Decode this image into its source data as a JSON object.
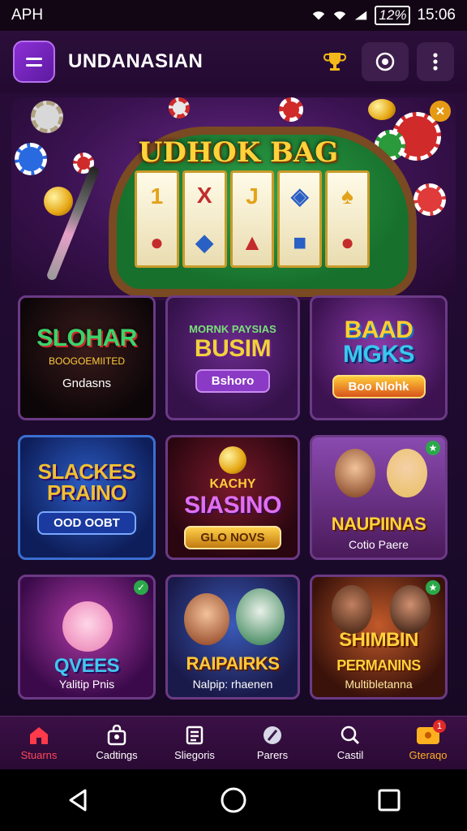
{
  "status_bar": {
    "left_text": "APH",
    "battery": "12%",
    "time": "15:06"
  },
  "header": {
    "title": "UNDANASIAN"
  },
  "banner": {
    "title": "UDHOK BAG"
  },
  "tiles": [
    {
      "title": "SLOHAR",
      "small": "",
      "sub1": "BOOGOEMIITED",
      "sub2": "Gndasns",
      "button": ""
    },
    {
      "title": "BUSIM",
      "small": "MORNK PAYSIAS",
      "sub1": "",
      "sub2": "",
      "button": "Bshoro"
    },
    {
      "title": "BAAD",
      "title2": "MGKS",
      "small": "",
      "sub1": "",
      "sub2": "",
      "button": "Boo Nlohk"
    },
    {
      "title": "SLACKES",
      "title2": "PRAINO",
      "small": "",
      "sub1": "",
      "sub2": "",
      "button": "OOD OOBT"
    },
    {
      "title": "SIASINO",
      "small": "KACHY",
      "sub1": "",
      "sub2": "",
      "button": "GLO NOVS"
    },
    {
      "title": "NAUPIINAS",
      "small": "",
      "sub1": "",
      "sub2": "Cotio Paere",
      "button": ""
    },
    {
      "title": "QVEES",
      "small": "",
      "sub1": "",
      "sub2": "Yalitip Pnis",
      "button": ""
    },
    {
      "title": "RAIPAIRKS",
      "small": "",
      "sub1": "",
      "sub2": "Nalpip: rhaenen",
      "button": ""
    },
    {
      "title": "PERMANINS",
      "title_top": "SHIMBIN",
      "small": "",
      "sub1": "",
      "sub2": "Multibletanna",
      "button": ""
    }
  ],
  "bottom_nav": [
    {
      "label": "Stuarns",
      "icon": "home-icon"
    },
    {
      "label": "Cadtings",
      "icon": "bag-icon"
    },
    {
      "label": "Sliegoris",
      "icon": "list-icon"
    },
    {
      "label": "Parers",
      "icon": "feather-icon"
    },
    {
      "label": "Castil",
      "icon": "search-icon"
    },
    {
      "label": "Gteraqo",
      "icon": "gift-icon",
      "badge": "1"
    }
  ],
  "colors": {
    "accent": "#8d2fd6",
    "active": "#ff4a5a",
    "gold": "#ffb020"
  }
}
